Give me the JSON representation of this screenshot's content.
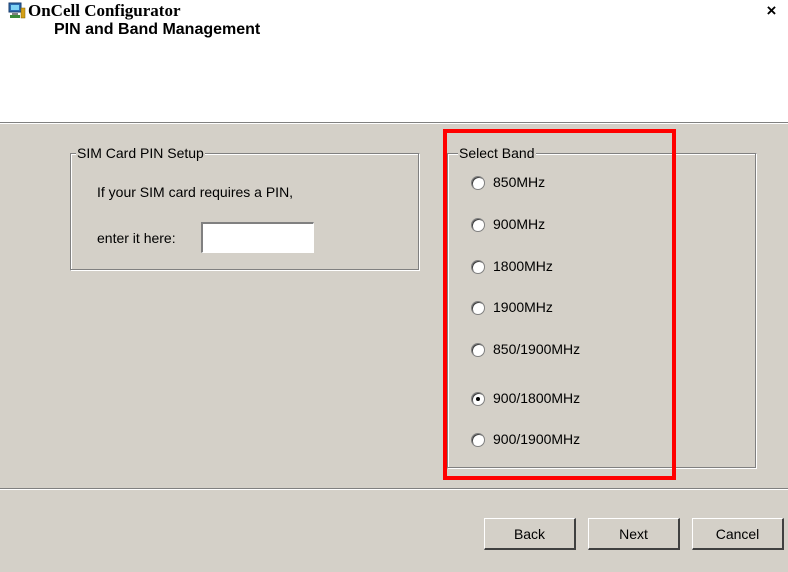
{
  "window": {
    "title": "OnCell Configurator",
    "close_label": "×",
    "icon": "computer-config-icon"
  },
  "header": {
    "subtitle": "PIN and Band Management"
  },
  "sim_group": {
    "legend": "SIM Card PIN Setup",
    "line1": "If your SIM card requires a PIN,",
    "line2": "enter it here:",
    "pin_value": ""
  },
  "band_group": {
    "legend": "Select Band",
    "options": [
      {
        "label": "850MHz",
        "checked": false
      },
      {
        "label": "900MHz",
        "checked": false
      },
      {
        "label": "1800MHz",
        "checked": false
      },
      {
        "label": "1900MHz",
        "checked": false
      },
      {
        "label": "850/1900MHz",
        "checked": false
      },
      {
        "label": "900/1800MHz",
        "checked": true
      },
      {
        "label": "900/1900MHz",
        "checked": false
      }
    ],
    "highlight_color": "#ff0000"
  },
  "buttons": {
    "back": "Back",
    "next": "Next",
    "cancel": "Cancel"
  },
  "colors": {
    "dialog_face": "#d4d0c8"
  }
}
